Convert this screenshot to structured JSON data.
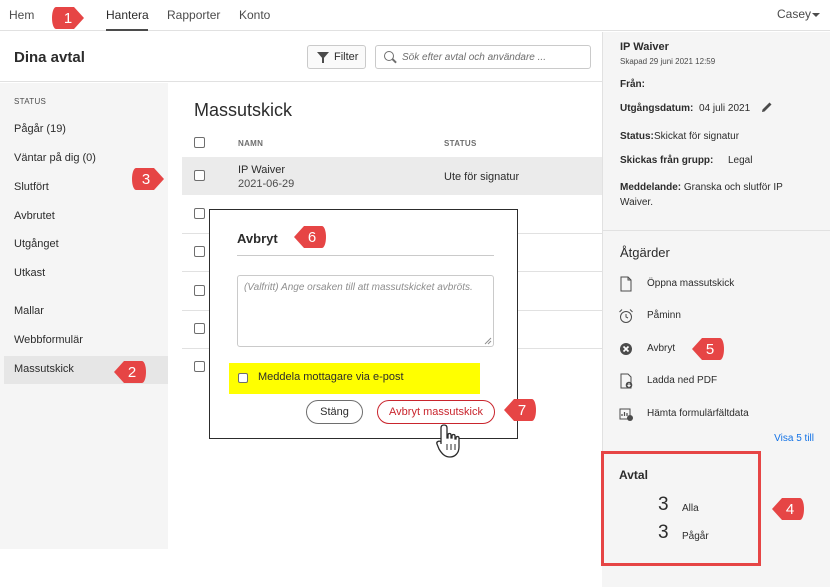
{
  "nav": {
    "items": [
      "Hem",
      "Hantera",
      "Rapporter",
      "Konto"
    ],
    "active": "Hantera",
    "user": "Casey"
  },
  "header": {
    "title": "Dina avtal",
    "filter_label": "Filter",
    "search_placeholder": "Sök efter avtal och användare ..."
  },
  "sidebar": {
    "status_heading": "STATUS",
    "items": [
      "Pågår (19)",
      "Väntar på dig (0)",
      "Slutfört",
      "Avbrutet",
      "Utgånget",
      "Utkast",
      "Mallar",
      "Webbformulär",
      "Massutskick"
    ],
    "selected": "Massutskick"
  },
  "list": {
    "title": "Massutskick",
    "columns": [
      "NAMN",
      "STATUS"
    ],
    "rows": [
      {
        "name": "IP Waiver",
        "date": "2021-06-29",
        "status": "Ute för signatur"
      }
    ]
  },
  "details": {
    "title": "IP Waiver",
    "created": "Skapad 29 juni 2021 12:59",
    "from_label": "Från:",
    "expiry_label": "Utgångsdatum:",
    "expiry_value": "04 juli 2021",
    "status_label": "Status:",
    "status_value": "Skickat för signatur",
    "group_label": "Skickas från grupp:",
    "group_value": "Legal",
    "message_label": "Meddelande:",
    "message_value": "Granska och slutför IP Waiver."
  },
  "actions": {
    "heading": "Åtgärder",
    "items": [
      {
        "label": "Öppna massutskick",
        "icon": "document-icon"
      },
      {
        "label": "Påminn",
        "icon": "alarm-clock-icon"
      },
      {
        "label": "Avbryt",
        "icon": "cancel-circle-icon"
      },
      {
        "label": "Ladda ned PDF",
        "icon": "pdf-download-icon"
      },
      {
        "label": "Hämta formulärfältdata",
        "icon": "form-data-icon"
      }
    ],
    "show_more": "Visa 5 till"
  },
  "stats": {
    "title": "Avtal",
    "rows": [
      {
        "count": "3",
        "label": "Alla"
      },
      {
        "count": "3",
        "label": "Pågår"
      }
    ]
  },
  "dialog": {
    "title": "Avbryt",
    "reason_placeholder": "(Valfritt) Ange orsaken till att massutskicket avbröts.",
    "notify_label": "Meddela mottagare via e-post",
    "close_label": "Stäng",
    "confirm_label": "Avbryt massutskick"
  },
  "callouts": [
    "1",
    "2",
    "3",
    "4",
    "5",
    "6",
    "7"
  ],
  "colors": {
    "callout": "#e64545",
    "highlight": "#ffff00",
    "danger": "#c9252d",
    "link": "#1473e6"
  }
}
